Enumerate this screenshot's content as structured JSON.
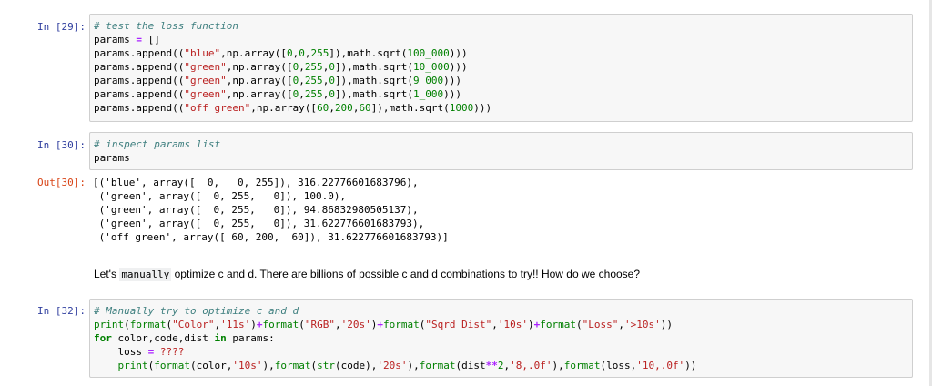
{
  "cells": {
    "c29": {
      "prompt": "In [29]:",
      "lines": [
        [
          {
            "t": "# test the loss function",
            "c": "cm-comment"
          }
        ],
        [
          {
            "t": "params ",
            "c": "cm-default"
          },
          {
            "t": "=",
            "c": "cm-op"
          },
          {
            "t": " []",
            "c": "cm-default"
          }
        ],
        [
          {
            "t": "params.append((",
            "c": "cm-default"
          },
          {
            "t": "\"blue\"",
            "c": "cm-string"
          },
          {
            "t": ",np.array([",
            "c": "cm-default"
          },
          {
            "t": "0",
            "c": "cm-number"
          },
          {
            "t": ",",
            "c": "cm-default"
          },
          {
            "t": "0",
            "c": "cm-number"
          },
          {
            "t": ",",
            "c": "cm-default"
          },
          {
            "t": "255",
            "c": "cm-number"
          },
          {
            "t": "]),math.sqrt(",
            "c": "cm-default"
          },
          {
            "t": "100_000",
            "c": "cm-number"
          },
          {
            "t": ")))",
            "c": "cm-default"
          }
        ],
        [
          {
            "t": "params.append((",
            "c": "cm-default"
          },
          {
            "t": "\"green\"",
            "c": "cm-string"
          },
          {
            "t": ",np.array([",
            "c": "cm-default"
          },
          {
            "t": "0",
            "c": "cm-number"
          },
          {
            "t": ",",
            "c": "cm-default"
          },
          {
            "t": "255",
            "c": "cm-number"
          },
          {
            "t": ",",
            "c": "cm-default"
          },
          {
            "t": "0",
            "c": "cm-number"
          },
          {
            "t": "]),math.sqrt(",
            "c": "cm-default"
          },
          {
            "t": "10_000",
            "c": "cm-number"
          },
          {
            "t": ")))",
            "c": "cm-default"
          }
        ],
        [
          {
            "t": "params.append((",
            "c": "cm-default"
          },
          {
            "t": "\"green\"",
            "c": "cm-string"
          },
          {
            "t": ",np.array([",
            "c": "cm-default"
          },
          {
            "t": "0",
            "c": "cm-number"
          },
          {
            "t": ",",
            "c": "cm-default"
          },
          {
            "t": "255",
            "c": "cm-number"
          },
          {
            "t": ",",
            "c": "cm-default"
          },
          {
            "t": "0",
            "c": "cm-number"
          },
          {
            "t": "]),math.sqrt(",
            "c": "cm-default"
          },
          {
            "t": "9_000",
            "c": "cm-number"
          },
          {
            "t": ")))",
            "c": "cm-default"
          }
        ],
        [
          {
            "t": "params.append((",
            "c": "cm-default"
          },
          {
            "t": "\"green\"",
            "c": "cm-string"
          },
          {
            "t": ",np.array([",
            "c": "cm-default"
          },
          {
            "t": "0",
            "c": "cm-number"
          },
          {
            "t": ",",
            "c": "cm-default"
          },
          {
            "t": "255",
            "c": "cm-number"
          },
          {
            "t": ",",
            "c": "cm-default"
          },
          {
            "t": "0",
            "c": "cm-number"
          },
          {
            "t": "]),math.sqrt(",
            "c": "cm-default"
          },
          {
            "t": "1_000",
            "c": "cm-number"
          },
          {
            "t": ")))",
            "c": "cm-default"
          }
        ],
        [
          {
            "t": "params.append((",
            "c": "cm-default"
          },
          {
            "t": "\"off green\"",
            "c": "cm-string"
          },
          {
            "t": ",np.array([",
            "c": "cm-default"
          },
          {
            "t": "60",
            "c": "cm-number"
          },
          {
            "t": ",",
            "c": "cm-default"
          },
          {
            "t": "200",
            "c": "cm-number"
          },
          {
            "t": ",",
            "c": "cm-default"
          },
          {
            "t": "60",
            "c": "cm-number"
          },
          {
            "t": "]),math.sqrt(",
            "c": "cm-default"
          },
          {
            "t": "1000",
            "c": "cm-number"
          },
          {
            "t": ")))",
            "c": "cm-default"
          }
        ]
      ]
    },
    "c30": {
      "prompt": "In [30]:",
      "lines": [
        [
          {
            "t": "# inspect params list",
            "c": "cm-comment"
          }
        ],
        [
          {
            "t": "params",
            "c": "cm-default"
          }
        ]
      ],
      "out_prompt": "Out[30]:",
      "output": [
        "[('blue', array([  0,   0, 255]), 316.22776601683796),",
        " ('green', array([  0, 255,   0]), 100.0),",
        " ('green', array([  0, 255,   0]), 94.86832980505137),",
        " ('green', array([  0, 255,   0]), 31.622776601683793),",
        " ('off green', array([ 60, 200,  60]), 31.622776601683793)]"
      ]
    },
    "markdown": {
      "before": "Let's ",
      "code": "manually",
      "after": " optimize c and d. There are billions of possible c and d combinations to try!! How do we choose?"
    },
    "c32": {
      "prompt": "In [32]:",
      "lines": [
        [
          {
            "t": "# Manually try to optimize c and d",
            "c": "cm-comment"
          }
        ],
        [
          {
            "t": "print",
            "c": "cm-fn"
          },
          {
            "t": "(",
            "c": "cm-default"
          },
          {
            "t": "format",
            "c": "cm-fn"
          },
          {
            "t": "(",
            "c": "cm-default"
          },
          {
            "t": "\"Color\"",
            "c": "cm-string"
          },
          {
            "t": ",",
            "c": "cm-default"
          },
          {
            "t": "'11s'",
            "c": "cm-string"
          },
          {
            "t": ")",
            "c": "cm-default"
          },
          {
            "t": "+",
            "c": "cm-op"
          },
          {
            "t": "format",
            "c": "cm-fn"
          },
          {
            "t": "(",
            "c": "cm-default"
          },
          {
            "t": "\"RGB\"",
            "c": "cm-string"
          },
          {
            "t": ",",
            "c": "cm-default"
          },
          {
            "t": "'20s'",
            "c": "cm-string"
          },
          {
            "t": ")",
            "c": "cm-default"
          },
          {
            "t": "+",
            "c": "cm-op"
          },
          {
            "t": "format",
            "c": "cm-fn"
          },
          {
            "t": "(",
            "c": "cm-default"
          },
          {
            "t": "\"Sqrd Dist\"",
            "c": "cm-string"
          },
          {
            "t": ",",
            "c": "cm-default"
          },
          {
            "t": "'10s'",
            "c": "cm-string"
          },
          {
            "t": ")",
            "c": "cm-default"
          },
          {
            "t": "+",
            "c": "cm-op"
          },
          {
            "t": "format",
            "c": "cm-fn"
          },
          {
            "t": "(",
            "c": "cm-default"
          },
          {
            "t": "\"Loss\"",
            "c": "cm-string"
          },
          {
            "t": ",",
            "c": "cm-default"
          },
          {
            "t": "'>10s'",
            "c": "cm-string"
          },
          {
            "t": "))",
            "c": "cm-default"
          }
        ],
        [
          {
            "t": "for",
            "c": "cm-kw"
          },
          {
            "t": " color,code,dist ",
            "c": "cm-default"
          },
          {
            "t": "in",
            "c": "cm-kw"
          },
          {
            "t": " params:",
            "c": "cm-default"
          }
        ],
        [
          {
            "t": "    loss ",
            "c": "cm-default"
          },
          {
            "t": "=",
            "c": "cm-op"
          },
          {
            "t": " ????",
            "c": "cm-string"
          }
        ],
        [
          {
            "t": "    ",
            "c": "cm-default"
          },
          {
            "t": "print",
            "c": "cm-fn"
          },
          {
            "t": "(",
            "c": "cm-default"
          },
          {
            "t": "format",
            "c": "cm-fn"
          },
          {
            "t": "(color,",
            "c": "cm-default"
          },
          {
            "t": "'10s'",
            "c": "cm-string"
          },
          {
            "t": "),",
            "c": "cm-default"
          },
          {
            "t": "format",
            "c": "cm-fn"
          },
          {
            "t": "(",
            "c": "cm-default"
          },
          {
            "t": "str",
            "c": "cm-fn"
          },
          {
            "t": "(code),",
            "c": "cm-default"
          },
          {
            "t": "'20s'",
            "c": "cm-string"
          },
          {
            "t": "),",
            "c": "cm-default"
          },
          {
            "t": "format",
            "c": "cm-fn"
          },
          {
            "t": "(dist",
            "c": "cm-default"
          },
          {
            "t": "**",
            "c": "cm-op"
          },
          {
            "t": "2",
            "c": "cm-number"
          },
          {
            "t": ",",
            "c": "cm-default"
          },
          {
            "t": "'8,.0f'",
            "c": "cm-string"
          },
          {
            "t": "),",
            "c": "cm-default"
          },
          {
            "t": "format",
            "c": "cm-fn"
          },
          {
            "t": "(loss,",
            "c": "cm-default"
          },
          {
            "t": "'10,.0f'",
            "c": "cm-string"
          },
          {
            "t": "))",
            "c": "cm-default"
          }
        ]
      ]
    }
  }
}
